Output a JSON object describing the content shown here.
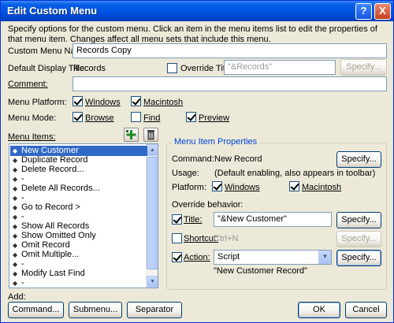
{
  "window": {
    "title": "Edit Custom Menu",
    "help_glyph": "?",
    "close_glyph": "X",
    "description": "Specify options for the custom menu. Click an item in the menu items list to edit the properties of that menu item. Changes affect all menu sets that include this menu."
  },
  "form": {
    "custom_menu_name_label": "Custom Menu Name:",
    "custom_menu_name_value": "Records Copy",
    "default_display_title_label": "Default Display Title:",
    "default_display_title_value": "Records",
    "override_title_label": "Override Title:",
    "override_title_value": "\"&Records\"",
    "override_title_checked": false,
    "specify_label": "Specify...",
    "comment_label": "Comment:",
    "comment_value": "",
    "menu_platform_label": "Menu Platform:",
    "platform_windows_label": "Windows",
    "platform_windows_checked": true,
    "platform_macintosh_label": "Macintosh",
    "platform_macintosh_checked": true,
    "menu_mode_label": "Menu Mode:",
    "mode_browse_label": "Browse",
    "mode_browse_checked": true,
    "mode_find_label": "Find",
    "mode_find_checked": false,
    "mode_preview_label": "Preview",
    "mode_preview_checked": true
  },
  "menu_items": {
    "label": "Menu Items:",
    "items": [
      "New Customer",
      "Duplicate Record",
      "Delete Record...",
      "-",
      "Delete All Records...",
      "-",
      "Go to Record >",
      "-",
      "Show All Records",
      "Show Omitted Only",
      "Omit Record",
      "Omit Multiple...",
      "-",
      "Modify Last Find",
      "-"
    ],
    "selected_index": 0
  },
  "properties": {
    "group_title": "Menu Item Properties",
    "command_label": "Command:",
    "command_value": "New Record",
    "specify_label": "Specify...",
    "usage_label": "Usage:",
    "usage_value": "(Default enabling, also appears in toolbar)",
    "platform_label": "Platform:",
    "platform_windows_label": "Windows",
    "platform_macintosh_label": "Macintosh",
    "override_behavior_label": "Override behavior:",
    "title_label": "Title:",
    "title_checked": true,
    "title_value": "\"&New Customer\"",
    "shortcut_label": "Shortcut:",
    "shortcut_checked": false,
    "shortcut_value": "Ctrl+N",
    "action_label": "Action:",
    "action_checked": true,
    "action_value": "Script",
    "action_script_name": "\"New Customer Record\""
  },
  "footer": {
    "add_label": "Add:",
    "command_button": "Command...",
    "submenu_button": "Submenu...",
    "separator_button": "Separator",
    "ok_button": "OK",
    "cancel_button": "Cancel"
  }
}
